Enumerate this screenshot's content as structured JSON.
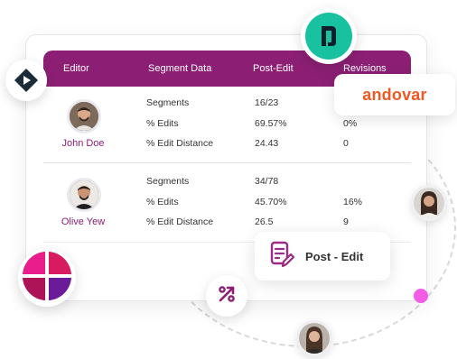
{
  "columns": {
    "editor": "Editor",
    "segment_data": "Segment Data",
    "post_edit": "Post-Edit",
    "revisions": "Revisions"
  },
  "rows": [
    {
      "name": "John Doe",
      "segments_label": "Segments",
      "edits_label": "% Edits",
      "distance_label": "% Edit Distance",
      "segments_post": "16/23",
      "edits_post": "69.57%",
      "distance_post": "24.43",
      "segments_rev": "",
      "edits_rev": "0%",
      "distance_rev": "0"
    },
    {
      "name": "Olive Yew",
      "segments_label": "Segments",
      "edits_label": "% Edits",
      "distance_label": "% Edit Distance",
      "segments_post": "34/78",
      "edits_post": "45.70%",
      "distance_post": "26.5",
      "segments_rev": "",
      "edits_rev": "16%",
      "distance_rev": "9"
    }
  ],
  "badges": {
    "andovar": "andovar",
    "post_edit": "Post - Edit"
  },
  "icons": {
    "top_logo": "bookmark-logo-icon",
    "left_logo": "play-diamond-icon",
    "percent": "percent-icon",
    "document": "document-edit-icon",
    "grid": "grid-circle-icon"
  },
  "colors": {
    "header": "#8c1f74",
    "accent_teal": "#18c2a0",
    "accent_orange": "#ef5a24",
    "pink_dot": "#f25ce6"
  }
}
